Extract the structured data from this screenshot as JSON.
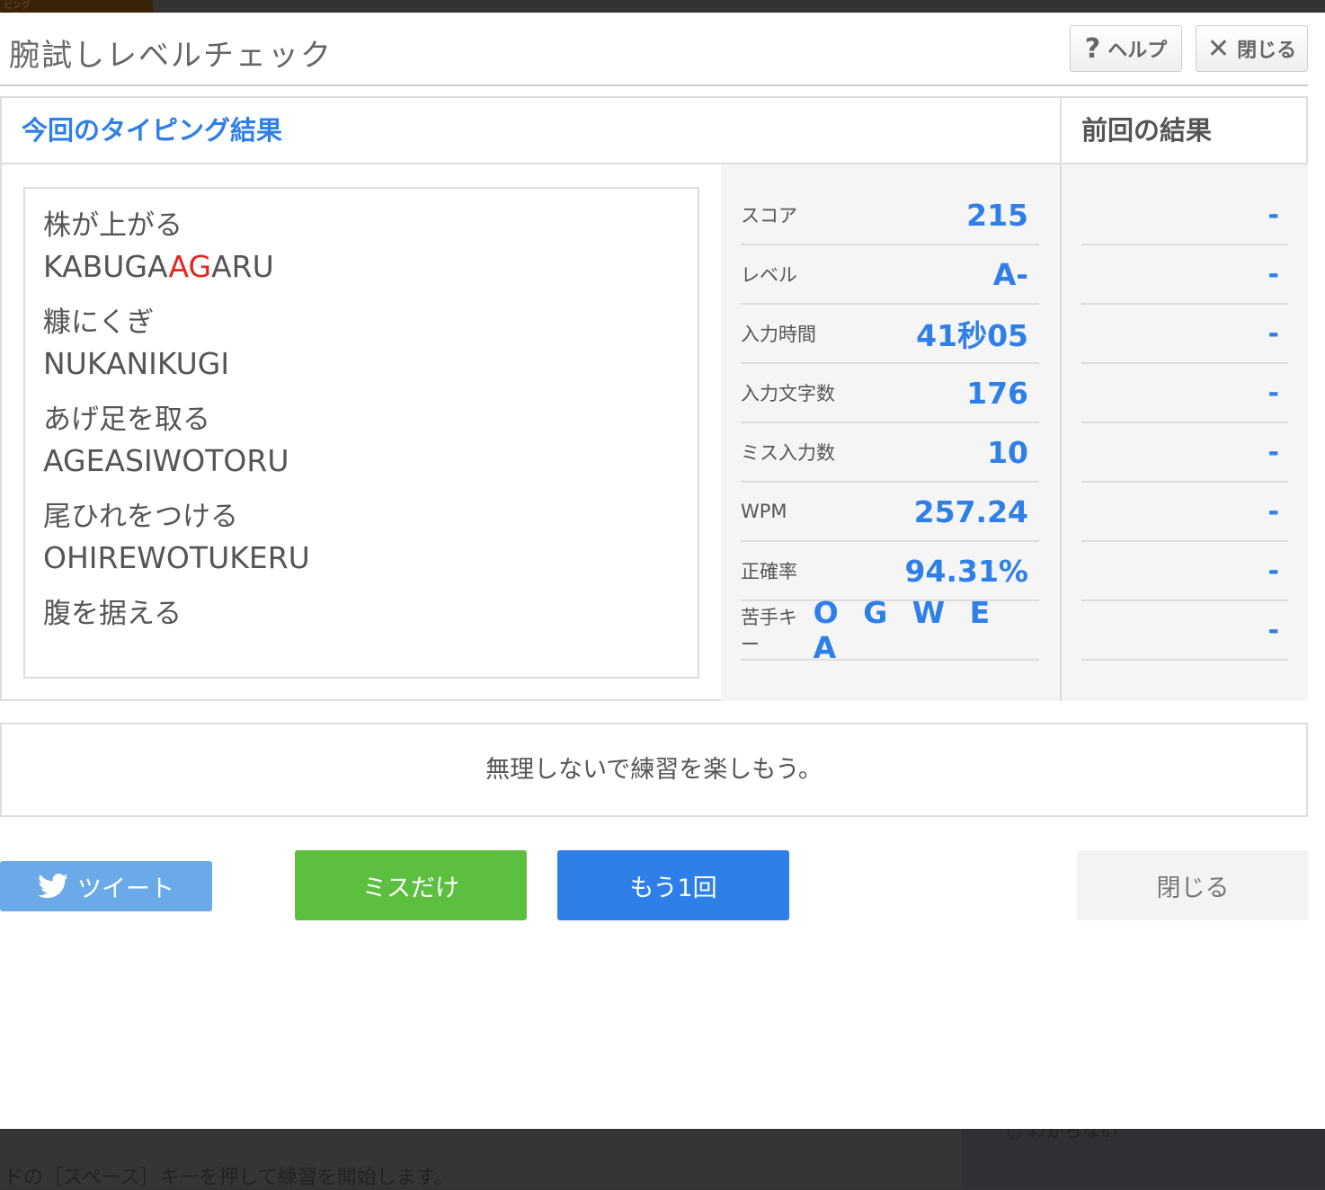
{
  "background": {
    "tab_label": "ピング",
    "instruction": "ドの［スペース］キーを押して練習を開始します。",
    "side_text": "○ わからない"
  },
  "header": {
    "title": "腕試しレベルチェック",
    "help_label": "ヘルプ",
    "close_label": "閉じる"
  },
  "results": {
    "current_title": "今回のタイピング結果",
    "previous_title": "前回の結果",
    "words": [
      {
        "jp": "株が上がる",
        "romaji_before": "KABUGA",
        "romaji_miss": "AG",
        "romaji_after": "ARU"
      },
      {
        "jp": "糠にくぎ",
        "romaji_before": "NUKANIKUGI",
        "romaji_miss": "",
        "romaji_after": ""
      },
      {
        "jp": "あげ足を取る",
        "romaji_before": "AGEASIWOTORU",
        "romaji_miss": "",
        "romaji_after": ""
      },
      {
        "jp": "尾ひれをつける",
        "romaji_before": "OHIREWOTUKERU",
        "romaji_miss": "",
        "romaji_after": ""
      },
      {
        "jp": "腹を据える",
        "romaji_before": "",
        "romaji_miss": "",
        "romaji_after": ""
      }
    ],
    "stats": [
      {
        "label": "スコア",
        "value": "215",
        "prev": "-"
      },
      {
        "label": "レベル",
        "value": "A-",
        "prev": "-"
      },
      {
        "label": "入力時間",
        "value": "41秒05",
        "prev": "-"
      },
      {
        "label": "入力文字数",
        "value": "176",
        "prev": "-"
      },
      {
        "label": "ミス入力数",
        "value": "10",
        "prev": "-"
      },
      {
        "label": "WPM",
        "value": "257.24",
        "prev": "-"
      },
      {
        "label": "正確率",
        "value": "94.31%",
        "prev": "-"
      },
      {
        "label": "苦手キー",
        "value": "O G W E A",
        "prev": "-"
      }
    ]
  },
  "message": "無理しないで練習を楽しもう。",
  "buttons": {
    "tweet": "ツイート",
    "miss_only": "ミスだけ",
    "retry": "もう1回",
    "close": "閉じる"
  },
  "colors": {
    "accent": "#2f7fe8",
    "miss": "#e8231c",
    "green": "#5cbf3f",
    "twitter": "#6aaae8"
  }
}
